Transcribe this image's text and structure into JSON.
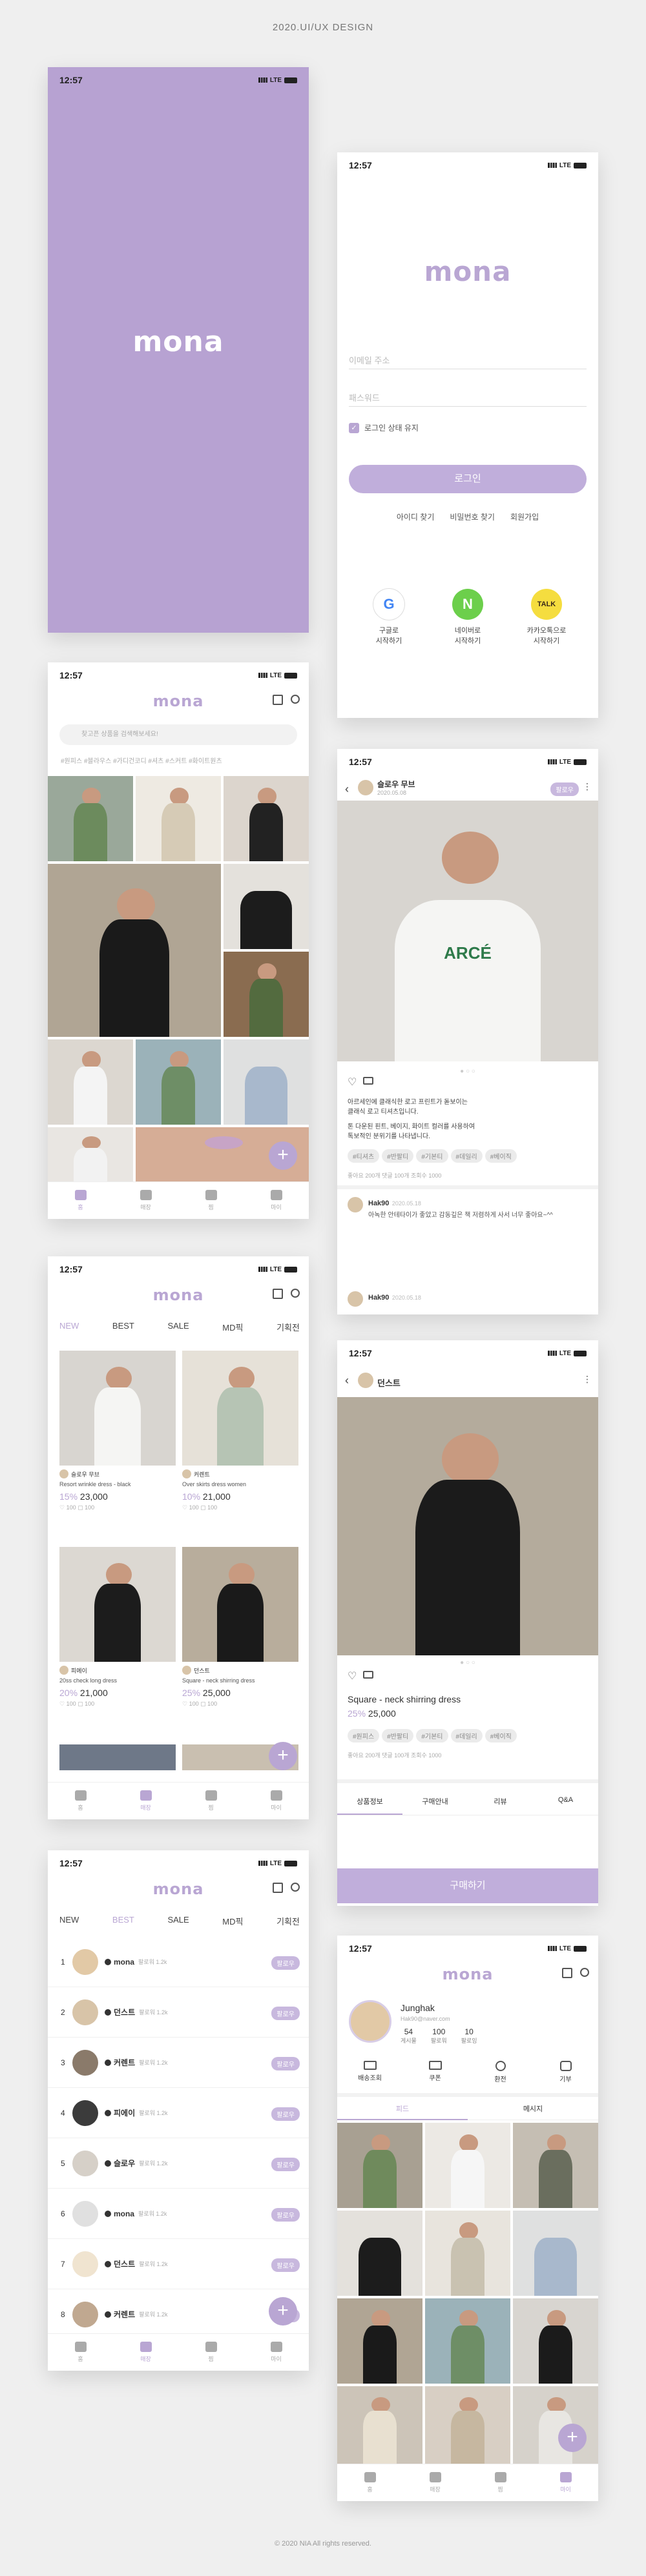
{
  "header": "2020.UI/UX DESIGN",
  "footer": "© 2020 NIA All rights reserved.",
  "status": {
    "time": "12:57",
    "net": "LTE"
  },
  "brand": "mona",
  "login": {
    "email_ph": "이메일 주소",
    "pw_ph": "패스워드",
    "keep": "로그인 상태 유지",
    "button": "로그인",
    "links": [
      "아이디 찾기",
      "비밀번호 찾기",
      "회원가입"
    ],
    "social": [
      {
        "label": "구글로\n시작하기",
        "mark": "G",
        "color": "#ffffff"
      },
      {
        "label": "네이버로\n시작하기",
        "mark": "N",
        "color": "#6ccf4b"
      },
      {
        "label": "카카오톡으로\n시작하기",
        "mark": "TALK",
        "color": "#f5dd3f"
      }
    ]
  },
  "home": {
    "search_ph": "찾고픈 상품을 검색해보세요!",
    "tags": "#원피스 #블라우스 #가디건코디 #셔츠 #스커트 #화이트원츠"
  },
  "tabs": [
    "홈",
    "매장",
    "찜",
    "마이"
  ],
  "post": {
    "user": "슬로우 무브",
    "date": "2020.05.08",
    "follow": "팔로우",
    "text1": "아르세인에 클래식한 로고 프린트가 돋보이는",
    "text2": "클래식 로고 티셔츠입니다.",
    "text3": "톤 다운된 핀트, 베이지, 화이트 컬러를 사용하여",
    "text4": "톡보적인 분위기를 나타냅니다.",
    "tags": [
      "#티셔츠",
      "#반팔티",
      "#기본티",
      "#데일리",
      "#베이직"
    ],
    "meta": "좋아요 200개 댓글 100개 조회수 1000",
    "comments": [
      {
        "user": "Hak90",
        "date": "2020.05.18",
        "text": "아녹한 안테타이가 좋았고 감동깊은 책 저렴하게 사서 너무 좋아요~^^"
      },
      {
        "user": "Hak90",
        "date": "2020.05.18",
        "text": ""
      }
    ]
  },
  "store": {
    "cats": [
      "NEW",
      "BEST",
      "SALE",
      "MD픽",
      "기획전"
    ],
    "items": [
      {
        "seller": "슬로우 무브",
        "name": "Resort wrinkle dress - black",
        "pct": "15%",
        "price": "23,000",
        "likes": "100",
        "cmts": "100"
      },
      {
        "seller": "커렌트",
        "name": "Over skirts dress women",
        "pct": "10%",
        "price": "21,000",
        "likes": "100",
        "cmts": "100"
      },
      {
        "seller": "피에이",
        "name": "20ss check long dress",
        "pct": "20%",
        "price": "21,000",
        "likes": "100",
        "cmts": "100"
      },
      {
        "seller": "던스트",
        "name": "Square - neck shirring dress",
        "pct": "25%",
        "price": "25,000",
        "likes": "100",
        "cmts": "100"
      }
    ]
  },
  "detail": {
    "seller": "던스트",
    "name": "Square - neck shirring dress",
    "pct": "25%",
    "price": "25,000",
    "tags": [
      "#원피스",
      "#반팔티",
      "#기본티",
      "#데일리",
      "#베이직"
    ],
    "meta": "좋아요 200개 댓글 100개 조회수 1000",
    "tabs": [
      "상품정보",
      "구매안내",
      "리뷰",
      "Q&A"
    ],
    "buy": "구매하기"
  },
  "ranking": {
    "follow": "팔로우",
    "sub": "팔로워 1.2k",
    "rows": [
      {
        "n": "1",
        "name": "mona"
      },
      {
        "n": "2",
        "name": "던스트"
      },
      {
        "n": "3",
        "name": "커렌트"
      },
      {
        "n": "4",
        "name": "피에이"
      },
      {
        "n": "5",
        "name": "슬로우"
      },
      {
        "n": "6",
        "name": "mona"
      },
      {
        "n": "7",
        "name": "던스트"
      },
      {
        "n": "8",
        "name": "커렌트"
      }
    ]
  },
  "mypage": {
    "name": "Junghak",
    "email": "Hak90@naver.com",
    "stats": [
      {
        "v": "54",
        "l": "게시물"
      },
      {
        "v": "100",
        "l": "팔로워"
      },
      {
        "v": "10",
        "l": "팔로잉"
      }
    ],
    "menu": [
      "배송조회",
      "쿠폰",
      "환전",
      "기부"
    ],
    "tabs": [
      "피드",
      "메시지"
    ]
  },
  "colors": {
    "accent": "#b9a6d3",
    "splash": "#b7a2d2",
    "naver": "#6ccf4b",
    "kakao": "#f5dd3f"
  }
}
